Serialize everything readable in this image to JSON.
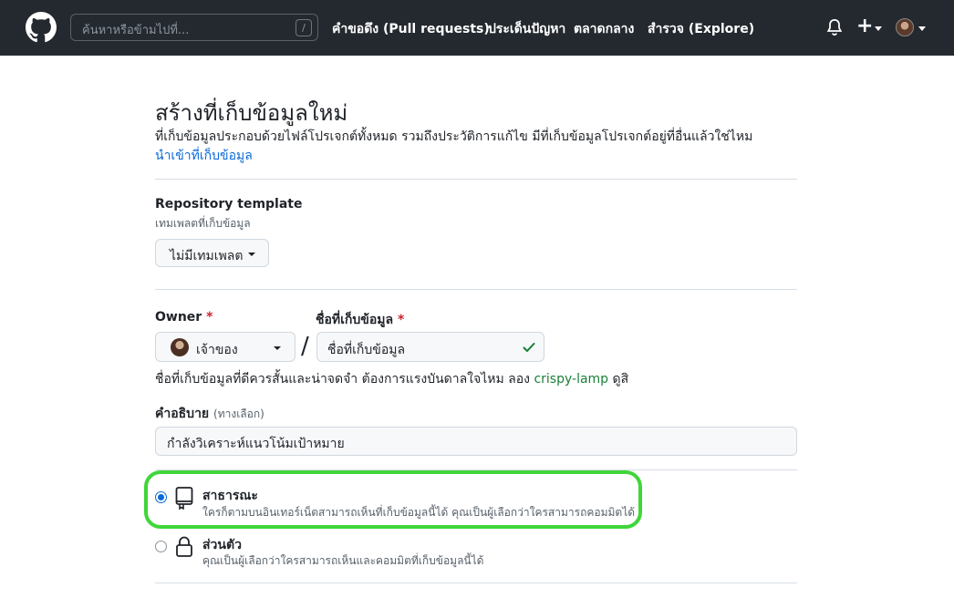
{
  "header": {
    "search_placeholder": "ค้นหาหรือข้ามไปที่...",
    "search_shortcut": "/",
    "nav": [
      {
        "label": "คำขอดึง (Pull requests)"
      },
      {
        "label": "ประเด็นปัญหา"
      },
      {
        "label": "ตลาดกลาง"
      },
      {
        "label": "สำรวจ (Explore)"
      }
    ],
    "plus_symbol": "+"
  },
  "page": {
    "title": "สร้างที่เก็บข้อมูลใหม่",
    "subtitle": "ที่เก็บข้อมูลประกอบด้วยไฟล์โปรเจกต์ทั้งหมด รวมถึงประวัติการแก้ไข มีที่เก็บข้อมูลโปรเจกต์อยู่ที่อื่นแล้วใช่ไหม",
    "import_link": "นำเข้าที่เก็บข้อมูล"
  },
  "template": {
    "label": "Repository template",
    "sublabel": "เทมเพลตที่เก็บข้อมูล",
    "button": "ไม่มีเทมเพลต"
  },
  "owner": {
    "label": "Owner",
    "required": "*",
    "value": "เจ้าของ"
  },
  "separator": "/",
  "repo_name": {
    "label": "ชื่อที่เก็บข้อมูล",
    "required": "*",
    "value": "ชื่อที่เก็บข้อมูล"
  },
  "helper": {
    "prefix": "ชื่อที่เก็บข้อมูลที่ดีควรสั้นและน่าจดจำ ต้องการแรงบันดาลใจไหม ลอง",
    "suggestion": "crispy-lamp",
    "suffix": "ดูสิ"
  },
  "description": {
    "label": "คำอธิบาย",
    "optional": "(ทางเลือก)",
    "value": "กำลังวิเคราะห์แนวโน้มเป้าหมาย"
  },
  "visibility": {
    "public": {
      "title": "สาธารณะ",
      "desc": "ใครก็ตามบนอินเทอร์เน็ตสามารถเห็นที่เก็บข้อมูลนี้ได้ คุณเป็นผู้เลือกว่าใครสามารถคอมมิตได้",
      "selected": true
    },
    "private": {
      "title": "ส่วนตัว",
      "desc": "คุณเป็นผู้เลือกว่าใครสามารถเห็นและคอมมิตที่เก็บข้อมูลนี้ได้",
      "selected": false
    }
  },
  "colors": {
    "header_bg": "#24292f",
    "link": "#0969da",
    "highlight": "#3fd63a",
    "success": "#1a7f37"
  }
}
